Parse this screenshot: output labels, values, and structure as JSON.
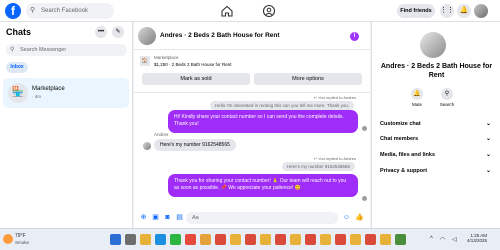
{
  "topbar": {
    "search_placeholder": "Search Facebook",
    "find_friends": "Find friends"
  },
  "left": {
    "title": "Chats",
    "search_placeholder": "Search Messenger",
    "filter": "Inbox",
    "conversation": {
      "name": "Marketplace",
      "sub": "· 4m"
    }
  },
  "chat": {
    "title": "Andres · 2 Beds 2 Bath House for Rent",
    "marketplace_label": "Marketplace",
    "listing": "$1,250 · 2 Beds 2 Bath House for Rent",
    "mark_sold": "Mark as sold",
    "more_options": "More options",
    "reply_tag_1": "You replied to Andres",
    "quoted_1": "Hello I'm interested in renting this can you tell me more. Thank you.",
    "msg_out_1": "Hi! Kindly share your contact number so I can send you the complete details. Thank you!",
    "sender": "Andres",
    "msg_in_1": "Here's my number 9162548565",
    "reply_tag_2": "You replied to Andres",
    "quoted_2": "Here's my number 9162548565",
    "msg_out_2": "Thank you for sharing your contact number! 🙏 Our team will reach out to you as soon as possible. 📌 We appreciate your patience! 😊",
    "composer_placeholder": "Aa"
  },
  "right": {
    "title": "Andres · 2 Beds 2 Bath House for Rent",
    "mute": "Mute",
    "search": "Search",
    "rows": [
      "Customize chat",
      "Chat members",
      "Media, files and links",
      "Privacy & support"
    ]
  },
  "taskbar": {
    "temp": "79°F",
    "weather": "Smoke",
    "time": "1:25 AM",
    "date": "4/13/2025"
  },
  "colors": {
    "accent": "#0866ff",
    "bubble": "#a02cf7"
  }
}
